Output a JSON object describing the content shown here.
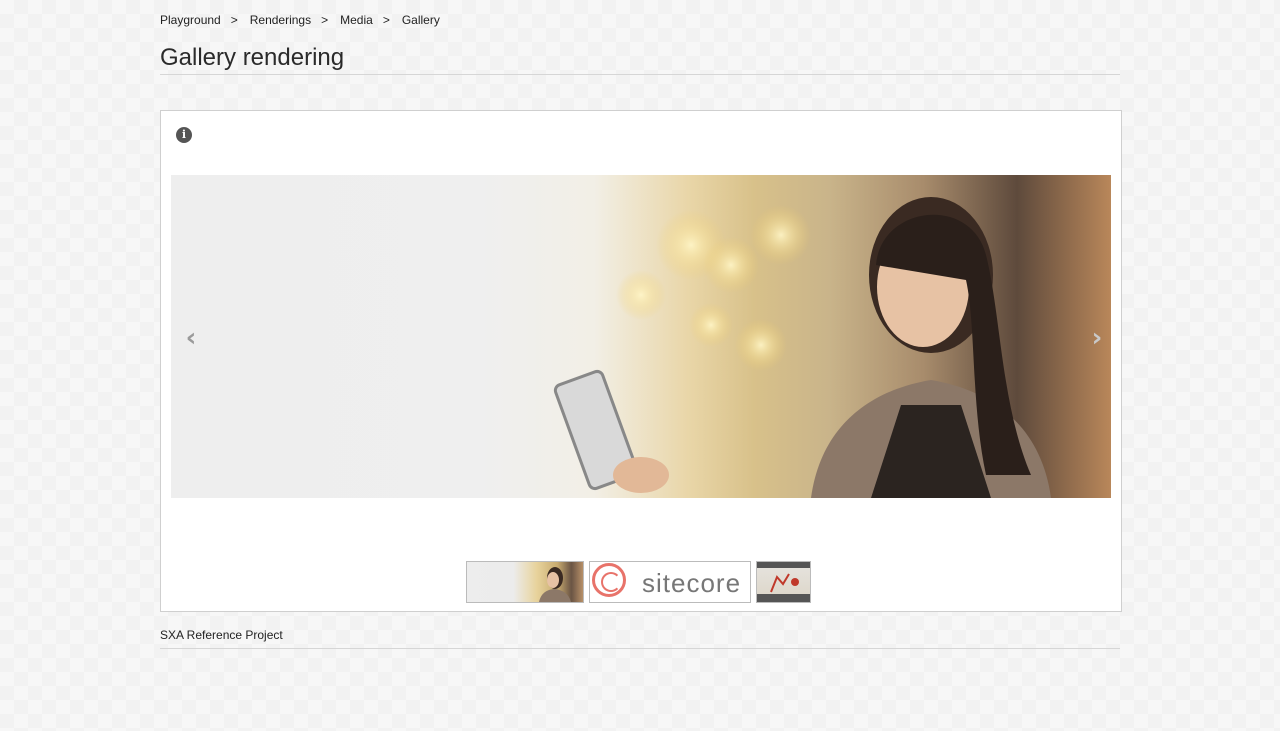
{
  "breadcrumb": {
    "items": [
      "Playground",
      "Renderings",
      "Media",
      "Gallery"
    ],
    "separator": ">"
  },
  "page": {
    "title": "Gallery rendering"
  },
  "gallery": {
    "info_icon": "info-icon",
    "prev_icon": "chevron-left-icon",
    "next_icon": "chevron-right-icon",
    "prev_glyph": "‹",
    "next_glyph": "›",
    "info_glyph": "i",
    "thumbnails": [
      {
        "alt": "woman-with-tablet-thumbnail"
      },
      {
        "alt": "sitecore-logo-thumbnail",
        "text": "sitecore"
      },
      {
        "alt": "presentation-thumbnail"
      }
    ]
  },
  "footer": {
    "text": "SXA Reference Project"
  },
  "colors": {
    "accent_logo": "#e8736a",
    "border": "#cfcfcf"
  }
}
